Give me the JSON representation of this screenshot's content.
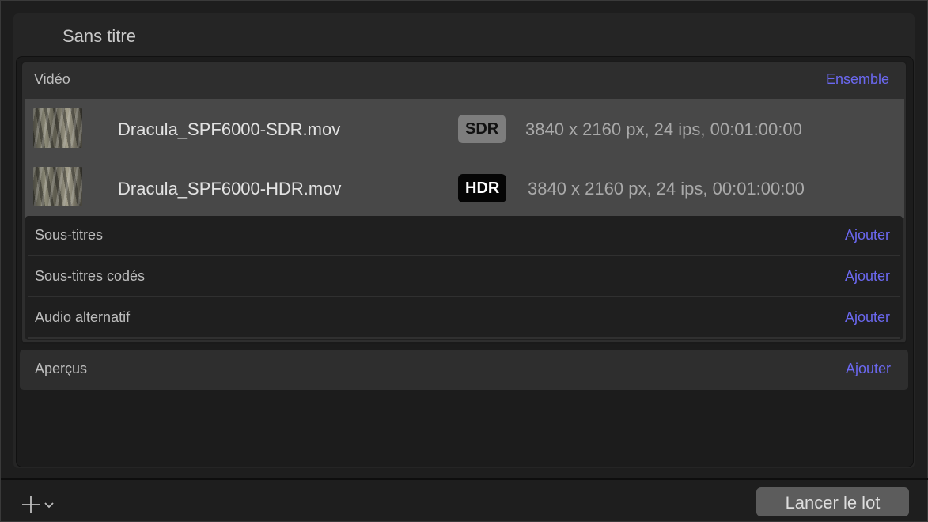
{
  "header": {
    "title": "Sans titre"
  },
  "video": {
    "label": "Vidéo",
    "action": "Ensemble",
    "clips": [
      {
        "name": "Dracula_SPF6000-SDR.mov",
        "badge": "SDR",
        "info": "3840 x 2160 px, 24 ips, 00:01:00:00"
      },
      {
        "name": "Dracula_SPF6000-HDR.mov",
        "badge": "HDR",
        "info": "3840 x 2160 px, 24 ips, 00:01:00:00"
      }
    ]
  },
  "extras": [
    {
      "label": "Sous-titres",
      "action": "Ajouter"
    },
    {
      "label": "Sous-titres codés",
      "action": "Ajouter"
    },
    {
      "label": "Audio alternatif",
      "action": "Ajouter"
    }
  ],
  "previews": {
    "label": "Aperçus",
    "action": "Ajouter"
  },
  "footer": {
    "add_icon": "plus-chevron-icon",
    "launch_label": "Lancer le lot"
  },
  "colors": {
    "accent": "#6b68f0",
    "sdr_badge": "#7d7d7d",
    "hdr_badge": "#050505"
  }
}
